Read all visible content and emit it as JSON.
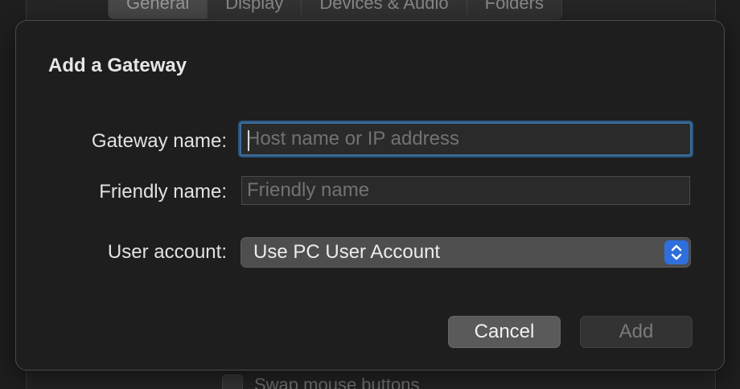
{
  "background": {
    "tabs": [
      {
        "label": "General",
        "active": true
      },
      {
        "label": "Display",
        "active": false
      },
      {
        "label": "Devices & Audio",
        "active": false
      },
      {
        "label": "Folders",
        "active": false
      }
    ],
    "checkbox_label": "Swap mouse buttons"
  },
  "sheet": {
    "title": "Add a Gateway",
    "gateway_label": "Gateway name:",
    "gateway_placeholder": "Host name or IP address",
    "gateway_value": "",
    "friendly_label": "Friendly name:",
    "friendly_placeholder": "Friendly name",
    "friendly_value": "",
    "user_label": "User account:",
    "user_value": "Use PC User Account",
    "cancel_label": "Cancel",
    "add_label": "Add"
  },
  "colors": {
    "accent": "#2f6fdb",
    "focus_ring": "#3d6d99",
    "sheet_bg": "#1e1e1e"
  }
}
